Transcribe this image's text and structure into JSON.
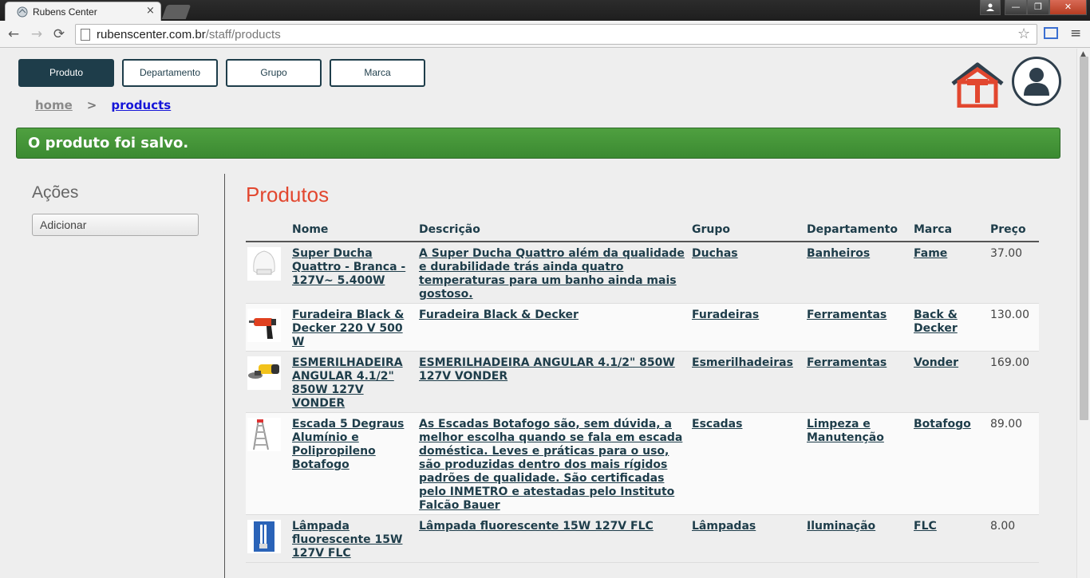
{
  "browser": {
    "tab_title": "Rubens Center",
    "tab_close": "×",
    "url_host": "rubenscenter.com.br",
    "url_path": "/staff/products",
    "back": "←",
    "forward": "→",
    "reload": "⟳",
    "star": "☆",
    "menu": "≡",
    "win_min": "—",
    "win_max": "❐",
    "win_close": "✕",
    "win_user": "👤"
  },
  "nav": {
    "produto": "Produto",
    "departamento": "Departamento",
    "grupo": "Grupo",
    "marca": "Marca"
  },
  "breadcrumb": {
    "home": "home",
    "sep": ">",
    "current": "products"
  },
  "alert": "O produto foi salvo.",
  "sidebar": {
    "title": "Ações",
    "add_button": "Adicionar"
  },
  "main": {
    "title": "Produtos",
    "columns": [
      "Nome",
      "Descrição",
      "Grupo",
      "Departamento",
      "Marca",
      "Preço"
    ],
    "rows": [
      {
        "image": "shower-icon",
        "name": "Super Ducha Quattro - Branca - 127V~ 5.400W",
        "description": "A Super Ducha Quattro além da qualidade e durabilidade trás ainda quatro temperaturas para um banho ainda mais gostoso.",
        "group": "Duchas",
        "department": "Banheiros",
        "brand": "Fame",
        "price": "37.00"
      },
      {
        "image": "drill-icon",
        "name": "Furadeira Black & Decker 220 V 500 W",
        "description": "Furadeira Black & Decker",
        "group": "Furadeiras",
        "department": "Ferramentas",
        "brand": "Back & Decker",
        "price": "130.00"
      },
      {
        "image": "grinder-icon",
        "name": "ESMERILHADEIRA ANGULAR 4.1/2\" 850W 127V VONDER",
        "description": "ESMERILHADEIRA ANGULAR 4.1/2\" 850W 127V VONDER",
        "group": "Esmerilhadeiras",
        "department": "Ferramentas",
        "brand": "Vonder",
        "price": "169.00"
      },
      {
        "image": "ladder-icon",
        "name": "Escada 5 Degraus Alumínio e Polipropileno Botafogo",
        "description": "As Escadas Botafogo são, sem dúvida, a melhor escolha quando se fala em escada doméstica. Leves e práticas para o uso, são produzidas dentro dos mais rígidos padrões de qualidade. São certificadas pelo INMETRO e atestadas pelo Instituto Falcão Bauer",
        "group": "Escadas",
        "department": "Limpeza e Manutenção",
        "brand": "Botafogo",
        "price": "89.00"
      },
      {
        "image": "lamp-icon",
        "name": "Lâmpada fluorescente 15W 127V FLC",
        "description": "Lâmpada fluorescente 15W 127V FLC",
        "group": "Lâmpadas",
        "department": "Iluminação",
        "brand": "FLC",
        "price": "8.00"
      }
    ]
  },
  "colors": {
    "primary": "#1e3d4a",
    "accent": "#e2472f",
    "alert": "#45963a"
  }
}
